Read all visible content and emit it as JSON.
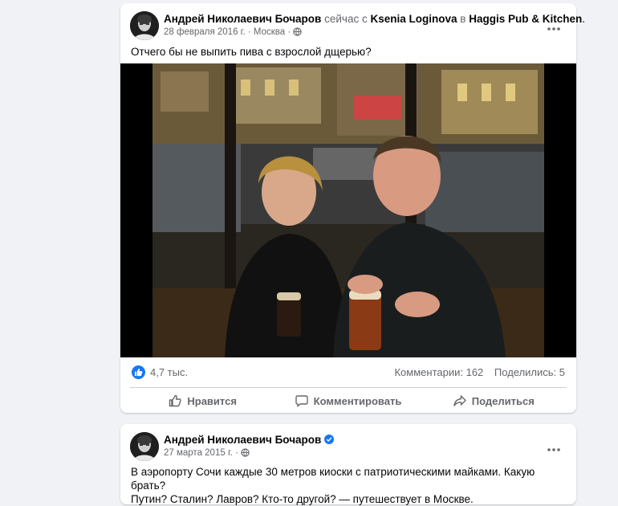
{
  "post1": {
    "author": "Андрей Николаевич Бочаров",
    "action_text": "сейчас с",
    "tagged_person": "Ksenia Loginova",
    "location_prep": "в",
    "place": "Haggis Pub & Kitchen",
    "place_suffix": ".",
    "date": "28 февраля 2016 г.",
    "separator": "·",
    "city": "Москва",
    "separator2": "·",
    "text": "Отчего бы не выпить пива с взрослой дщерью?",
    "likes_count": "4,7 тыс.",
    "comments": "Комментарии: 162",
    "shares": "Поделились: 5",
    "actions": {
      "like": "Нравится",
      "comment": "Комментировать",
      "share": "Поделиться"
    },
    "more_icon": "more-horizontal-icon"
  },
  "post2": {
    "author": "Андрей Николаевич Бочаров",
    "date": "27 марта 2015 г.",
    "separator": "·",
    "text": "В аэропорту Сочи каждые 30 метров киоски с патриотическими майками. Какую брать?",
    "text2": "Путин? Сталин? Лавров? Кто-то другой? — путешествует в Москве."
  },
  "colors": {
    "accent": "#1877f2",
    "background": "#f0f2f5",
    "muted": "#65676b"
  }
}
